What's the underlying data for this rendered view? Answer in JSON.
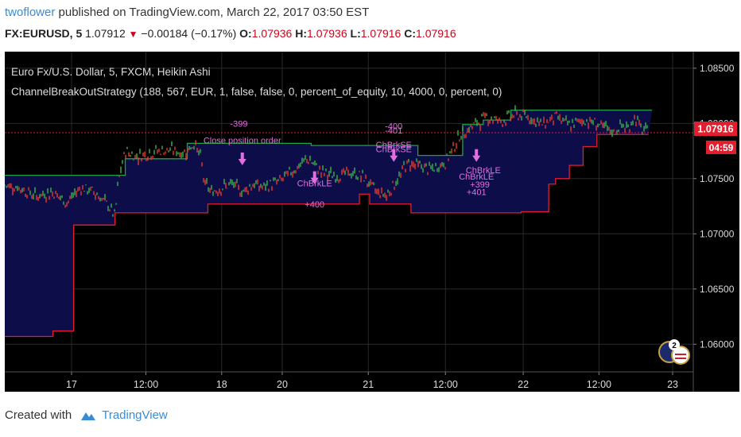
{
  "header": {
    "author": "twoflower",
    "published_text": " published on TradingView.com, March 22, 2017 03:50 EST",
    "symbol": "FX:EURUSD, 5",
    "last": "1.07912",
    "change": "−0.00184 (−0.17%)",
    "open_label": "O:",
    "open": "1.07936",
    "high_label": "H:",
    "high": "1.07936",
    "low_label": "L:",
    "low": "1.07916",
    "close_label": "C:",
    "close": "1.07916"
  },
  "chart_title": "Euro Fx/U.S. Dollar, 5, FXCM, Heikin Ashi",
  "strategy_label": "ChannelBreakOutStrategy (188, 567, EUR, 1, false, false, 0, percent_of_equity, 10, 4000, 0, percent, 0)",
  "price_badge": "1.07916",
  "time_badge": "04:59",
  "colors": {
    "background": "#000000",
    "channel_fill": "#0d0d4a",
    "upper_band": "#1fa34a",
    "lower_band": "#e01e2e",
    "candle_up": "#3bb34a",
    "candle_down": "#e8392e",
    "marker": "#e070e0",
    "price_line": "#e01e2e"
  },
  "chart_data": {
    "type": "line",
    "title": "Euro Fx/U.S. Dollar, 5, FXCM, Heikin Ashi",
    "ylim": [
      1.0575,
      1.0865
    ],
    "y_ticks": [
      1.085,
      1.08,
      1.075,
      1.07,
      1.065,
      1.06
    ],
    "y_tick_labels": [
      "1.08500",
      "1.08000",
      "1.07500",
      "1.07000",
      "1.06500",
      "1.06000"
    ],
    "x_tick_labels": [
      "17",
      "12:00",
      "18",
      "20",
      "21",
      "12:00",
      "22",
      "12:00",
      "23"
    ],
    "x_tick_positions": [
      0.097,
      0.205,
      0.315,
      0.403,
      0.528,
      0.64,
      0.753,
      0.863,
      0.97
    ],
    "last_price": 1.07916,
    "price_series": {
      "name": "EURUSD Heikin Ashi",
      "x": [
        0,
        0.02,
        0.045,
        0.07,
        0.09,
        0.11,
        0.13,
        0.15,
        0.16,
        0.165,
        0.175,
        0.19,
        0.22,
        0.24,
        0.26,
        0.275,
        0.285,
        0.29,
        0.3,
        0.315,
        0.33,
        0.345,
        0.36,
        0.375,
        0.4,
        0.42,
        0.44,
        0.46,
        0.48,
        0.5,
        0.52,
        0.54,
        0.555,
        0.565,
        0.575,
        0.58,
        0.59,
        0.6,
        0.62,
        0.64,
        0.66,
        0.68,
        0.7,
        0.72,
        0.74,
        0.76,
        0.78,
        0.8,
        0.82,
        0.84,
        0.86,
        0.875,
        0.885,
        0.895,
        0.905,
        0.915,
        0.925,
        0.935
      ],
      "y": [
        1.0744,
        1.0742,
        1.0734,
        1.0738,
        1.0728,
        1.0742,
        1.0738,
        1.0726,
        1.0716,
        1.0748,
        1.0775,
        1.077,
        1.0775,
        1.0776,
        1.0773,
        1.0782,
        1.0768,
        1.0745,
        1.0738,
        1.0742,
        1.0745,
        1.0738,
        1.0745,
        1.0742,
        1.0748,
        1.0758,
        1.0768,
        1.0756,
        1.0752,
        1.0755,
        1.0752,
        1.0738,
        1.0735,
        1.0745,
        1.0752,
        1.0762,
        1.0764,
        1.0762,
        1.0758,
        1.0765,
        1.0788,
        1.0798,
        1.0806,
        1.0802,
        1.0808,
        1.0806,
        1.0799,
        1.0806,
        1.0798,
        1.0803,
        1.08,
        1.0794,
        1.0792,
        1.0798,
        1.0795,
        1.0806,
        1.0794,
        1.0792
      ]
    },
    "upper_band": {
      "name": "Upper Channel",
      "x": [
        0,
        0.165,
        0.175,
        0.255,
        0.265,
        0.43,
        0.445,
        0.56,
        0.6,
        0.625,
        0.665,
        0.695,
        0.735,
        0.935,
        0.94
      ],
      "y": [
        1.0753,
        1.0753,
        1.0768,
        1.0768,
        1.0782,
        1.0782,
        1.078,
        1.078,
        1.0771,
        1.0771,
        1.0799,
        1.0803,
        1.0812,
        1.0812,
        1.0812
      ]
    },
    "lower_band": {
      "name": "Lower Channel",
      "x": [
        0,
        0.04,
        0.07,
        0.1,
        0.16,
        0.27,
        0.295,
        0.515,
        0.53,
        0.59,
        0.62,
        0.75,
        0.79,
        0.8,
        0.82,
        0.84,
        0.86,
        0.935
      ],
      "y": [
        1.0607,
        1.0607,
        1.0612,
        1.0708,
        1.0719,
        1.0719,
        1.0727,
        1.0736,
        1.0727,
        1.0719,
        1.0719,
        1.072,
        1.0745,
        1.075,
        1.0762,
        1.0779,
        1.079,
        1.079
      ]
    },
    "annotations": [
      {
        "text": "-399",
        "x": 0.34,
        "y": 1.0797
      },
      {
        "text": "Close position order",
        "x": 0.345,
        "y": 1.0782
      },
      {
        "text": "ChBrkLE",
        "x": 0.45,
        "y": 1.0743
      },
      {
        "text": "+400",
        "x": 0.45,
        "y": 1.0724
      },
      {
        "text": "-400",
        "x": 0.565,
        "y": 1.0795
      },
      {
        "text": "-401",
        "x": 0.565,
        "y": 1.0791
      },
      {
        "text": "ChBrkSE",
        "x": 0.565,
        "y": 1.0778
      },
      {
        "text": "ChBrkSE",
        "x": 0.565,
        "y": 1.0774
      },
      {
        "text": "ChBrkLE",
        "x": 0.695,
        "y": 1.0755
      },
      {
        "text": "ChBrkLE",
        "x": 0.685,
        "y": 1.0749
      },
      {
        "text": "+399",
        "x": 0.69,
        "y": 1.0742
      },
      {
        "text": "+401",
        "x": 0.685,
        "y": 1.0735
      }
    ],
    "arrows": [
      {
        "x": 0.345,
        "y": 1.0765
      },
      {
        "x": 0.45,
        "y": 1.0748
      },
      {
        "x": 0.565,
        "y": 1.0768
      },
      {
        "x": 0.685,
        "y": 1.0768
      }
    ],
    "grid": true
  },
  "footer": {
    "created_with": "Created with",
    "brand": "TradingView"
  }
}
